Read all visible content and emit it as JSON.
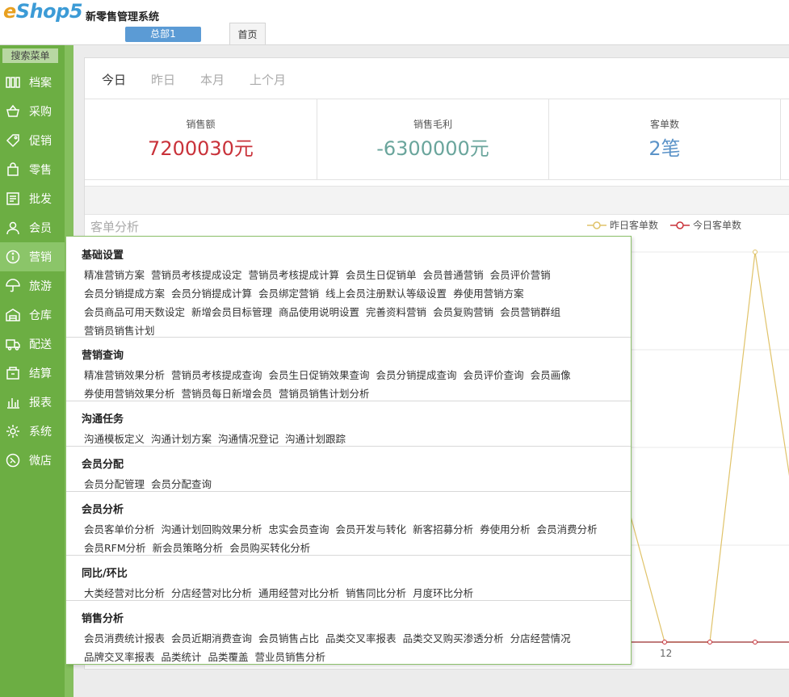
{
  "header": {
    "logo_e": "e",
    "logo_shop": "Shop5",
    "app_title": "新零售管理系统",
    "branch": "总部1",
    "home_tab": "首页"
  },
  "sidebar": {
    "search_label": "搜索菜单",
    "items": [
      {
        "label": "档案",
        "icon": "archive-icon"
      },
      {
        "label": "采购",
        "icon": "basket-icon"
      },
      {
        "label": "促销",
        "icon": "tag-icon"
      },
      {
        "label": "零售",
        "icon": "bag-icon"
      },
      {
        "label": "批发",
        "icon": "invoice-icon"
      },
      {
        "label": "会员",
        "icon": "user-icon"
      },
      {
        "label": "营销",
        "icon": "info-icon"
      },
      {
        "label": "旅游",
        "icon": "umbrella-icon"
      },
      {
        "label": "仓库",
        "icon": "warehouse-icon"
      },
      {
        "label": "配送",
        "icon": "truck-icon"
      },
      {
        "label": "结算",
        "icon": "wallet-icon"
      },
      {
        "label": "报表",
        "icon": "bar-chart-icon"
      },
      {
        "label": "系统",
        "icon": "gear-icon"
      },
      {
        "label": "微店",
        "icon": "shop-icon"
      }
    ],
    "active_index": 6
  },
  "dashboard": {
    "date_tabs": [
      "今日",
      "昨日",
      "本月",
      "上个月"
    ],
    "stats": [
      {
        "label": "销售额",
        "value": "7200030元",
        "color": "#c9323a"
      },
      {
        "label": "销售毛利",
        "value": "-6300000元",
        "color": "#6aa59c"
      },
      {
        "label": "客单数",
        "value": "2笔",
        "color": "#5b93c8"
      }
    ],
    "chart_title": "客单分析",
    "legend": [
      {
        "name": "昨日客单数",
        "color": "#e0c36a"
      },
      {
        "name": "今日客单数",
        "color": "#c9323a"
      }
    ]
  },
  "chart_data": {
    "type": "line",
    "title": "客单分析",
    "x_visible_tick": "12",
    "series": [
      {
        "name": "昨日客单数",
        "color": "#e0c36a",
        "note_points": [
          0,
          0,
          1,
          0
        ]
      },
      {
        "name": "今日客单数",
        "color": "#c9323a",
        "note_points": [
          0,
          0,
          0,
          0
        ]
      }
    ]
  },
  "menu": {
    "sections": [
      {
        "title": "基础设置",
        "lines": [
          [
            "精准营销方案",
            "营销员考核提成设定",
            "营销员考核提成计算",
            "会员生日促销单",
            "会员普通营销",
            "会员评价营销"
          ],
          [
            "会员分销提成方案",
            "会员分销提成计算",
            "会员绑定营销",
            "线上会员注册默认等级设置",
            "券使用营销方案"
          ],
          [
            "会员商品可用天数设定",
            "新增会员目标管理",
            "商品使用说明设置",
            "完善资料营销",
            "会员复购营销",
            "会员营销群组"
          ],
          [
            "营销员销售计划"
          ]
        ]
      },
      {
        "title": "营销查询",
        "lines": [
          [
            "精准营销效果分析",
            "营销员考核提成查询",
            "会员生日促销效果查询",
            "会员分销提成查询",
            "会员评价查询",
            "会员画像"
          ],
          [
            "券使用营销效果分析",
            "营销员每日新增会员",
            "营销员销售计划分析"
          ]
        ]
      },
      {
        "title": "沟通任务",
        "lines": [
          [
            "沟通模板定义",
            "沟通计划方案",
            "沟通情况登记",
            "沟通计划跟踪"
          ]
        ]
      },
      {
        "title": "会员分配",
        "lines": [
          [
            "会员分配管理",
            "会员分配查询"
          ]
        ]
      },
      {
        "title": "会员分析",
        "lines": [
          [
            "会员客单价分析",
            "沟通计划回购效果分析",
            "忠实会员查询",
            "会员开发与转化",
            "新客招募分析",
            "券使用分析",
            "会员消费分析"
          ],
          [
            "会员RFM分析",
            "新会员策略分析",
            "会员购买转化分析"
          ]
        ]
      },
      {
        "title": "同比/环比",
        "lines": [
          [
            "大类经营对比分析",
            "分店经营对比分析",
            "通用经营对比分析",
            "销售同比分析",
            "月度环比分析"
          ]
        ]
      },
      {
        "title": "销售分析",
        "lines": [
          [
            "会员消费统计报表",
            "会员近期消费查询",
            "会员销售占比",
            "品类交叉率报表",
            "品类交叉购买渗透分析",
            "分店经营情况"
          ],
          [
            "品牌交叉率报表",
            "品类统计",
            "品类覆盖",
            "营业员销售分析"
          ]
        ]
      }
    ]
  }
}
